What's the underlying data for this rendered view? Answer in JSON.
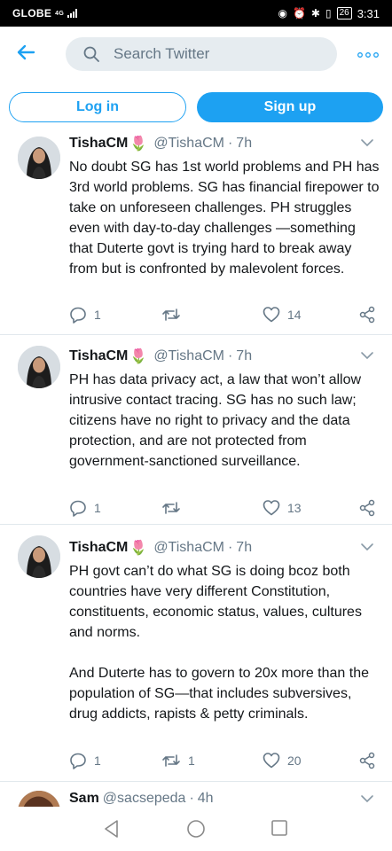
{
  "status_bar": {
    "carrier": "GLOBE",
    "network": "4G",
    "battery": "26",
    "time": "3:31"
  },
  "header": {
    "search_placeholder": "Search Twitter"
  },
  "auth": {
    "login_label": "Log in",
    "signup_label": "Sign up"
  },
  "colors": {
    "accent": "#1da1f2",
    "muted": "#657786",
    "search_bg": "#e6ecf0"
  },
  "tweets": [
    {
      "name": "TishaCM",
      "emoji": "🌷",
      "handle": "@TishaCM",
      "separator": "·",
      "time": "7h",
      "text": "No doubt SG has 1st world problems and PH has 3rd world problems. SG has financial firepower to take on unforeseen challenges. PH struggles even with day-to-day challenges —something that Duterte govt is trying hard to break away from but is confronted by malevolent forces.",
      "replies": "1",
      "retweets": "",
      "likes": "14"
    },
    {
      "name": "TishaCM",
      "emoji": "🌷",
      "handle": "@TishaCM",
      "separator": "·",
      "time": "7h",
      "text": "PH has data privacy act, a law that won’t allow intrusive contact tracing. SG has no such law; citizens have no right to privacy and the data protection, and are not protected from government-sanctioned surveillance.",
      "replies": "1",
      "retweets": "",
      "likes": "13"
    },
    {
      "name": "TishaCM",
      "emoji": "🌷",
      "handle": "@TishaCM",
      "separator": "·",
      "time": "7h",
      "text": "PH govt can’t do what SG is doing bcoz both countries have very different Constitution, constituents, economic status, values, cultures and norms.\n\nAnd Duterte has to govern to 20x more than the population of SG—that includes subversives, drug addicts, rapists & petty criminals.",
      "replies": "1",
      "retweets": "1",
      "likes": "20"
    },
    {
      "name": "Sam",
      "emoji": "",
      "handle": "@sacsepeda",
      "separator": "·",
      "time": "4h"
    }
  ],
  "icons": {
    "back": "back-arrow-icon",
    "search": "search-icon",
    "more": "more-dots-icon",
    "reply": "reply-icon",
    "retweet": "retweet-icon",
    "like": "like-icon",
    "share": "share-icon",
    "caret": "chevron-down-icon",
    "nav_back": "nav-back-icon",
    "nav_home": "nav-home-icon",
    "nav_recent": "nav-recent-icon"
  }
}
